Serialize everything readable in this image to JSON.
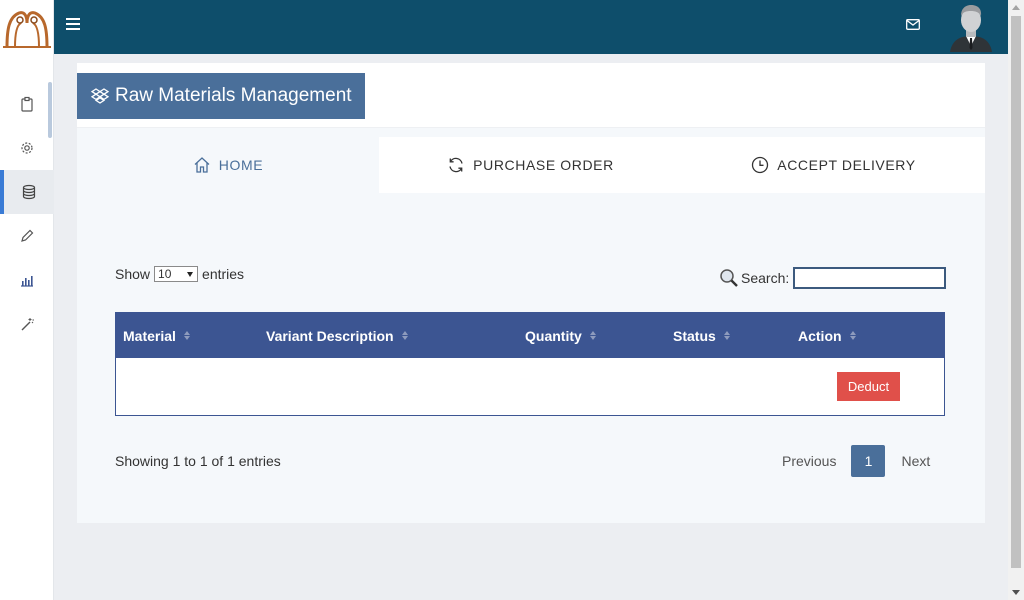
{
  "colors": {
    "topbar": "#0e4e6b",
    "accent": "#4a6f9a",
    "table_header": "#3c5592",
    "danger": "#e0504a"
  },
  "sidebar": {
    "logo": "app-logo",
    "items": [
      {
        "icon": "clipboard-icon"
      },
      {
        "icon": "gear-icon"
      },
      {
        "icon": "database-icon",
        "active": true
      },
      {
        "icon": "pencil-icon"
      },
      {
        "icon": "bar-chart-icon"
      },
      {
        "icon": "magic-wand-icon"
      }
    ]
  },
  "topbar": {
    "menu_icon": "hamburger-icon",
    "mail_icon": "mail-icon",
    "avatar": "user-avatar"
  },
  "page": {
    "title": "Raw Materials Management",
    "title_icon": "dropbox-icon"
  },
  "tabs": [
    {
      "label": "HOME",
      "icon": "home-icon",
      "active": true
    },
    {
      "label": "PURCHASE ORDER",
      "icon": "refresh-icon"
    },
    {
      "label": "ACCEPT DELIVERY",
      "icon": "clock-icon"
    }
  ],
  "table_controls": {
    "show_label": "Show",
    "entries_value": "10",
    "entries_label": "entries",
    "search_label": "Search:",
    "search_value": ""
  },
  "table": {
    "columns": [
      "Material",
      "Variant Description",
      "Quantity",
      "Status",
      "Action"
    ],
    "rows": [
      {
        "material": "",
        "variant": "",
        "quantity": "",
        "status": "",
        "action": "Deduct"
      }
    ]
  },
  "pagination": {
    "info": "Showing 1 to 1 of 1 entries",
    "prev": "Previous",
    "current": "1",
    "next": "Next"
  }
}
